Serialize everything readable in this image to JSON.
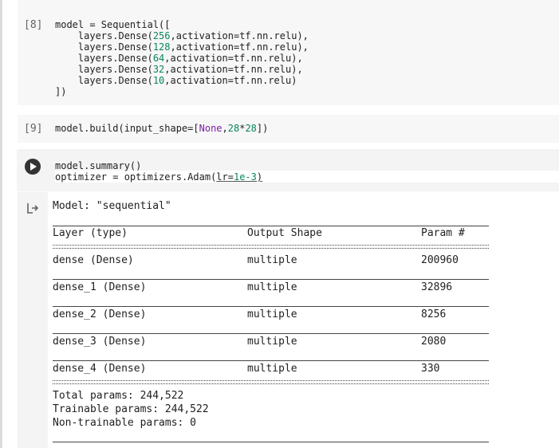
{
  "cells": [
    {
      "exec_count": "[8]",
      "lines": [
        "model = Sequential([",
        "    layers.Dense(256,activation=tf.nn.relu),",
        "    layers.Dense(128,activation=tf.nn.relu),",
        "    layers.Dense(64,activation=tf.nn.relu),",
        "    layers.Dense(32,activation=tf.nn.relu),",
        "    layers.Dense(10,activation=tf.nn.relu)",
        "])"
      ]
    },
    {
      "exec_count": "[9]",
      "code_prefix": "model.build(input_shape=[",
      "code_none": "None",
      "code_sep": ",",
      "code_num1": "28",
      "code_star": "*",
      "code_num2": "28",
      "code_suffix": "])"
    },
    {
      "line1": "model.summary()",
      "line2_prefix": "optimizer = optimizers.Adam(",
      "line2_arg": "lr",
      "line2_eq": "=",
      "line2_val": "1e-3",
      "line2_suffix": ")"
    }
  ],
  "output": {
    "model_name": "Model: \"sequential\"",
    "header": {
      "layer": "Layer (type)",
      "shape": "Output Shape",
      "param": "Param #"
    },
    "rows": [
      {
        "layer": "dense (Dense)",
        "shape": "multiple",
        "param": "200960"
      },
      {
        "layer": "dense_1 (Dense)",
        "shape": "multiple",
        "param": "32896"
      },
      {
        "layer": "dense_2 (Dense)",
        "shape": "multiple",
        "param": "8256"
      },
      {
        "layer": "dense_3 (Dense)",
        "shape": "multiple",
        "param": "2080"
      },
      {
        "layer": "dense_4 (Dense)",
        "shape": "multiple",
        "param": "330"
      }
    ],
    "total": "Total params: 244,522",
    "trainable": "Trainable params: 244,522",
    "non_trainable": "Non-trainable params: 0"
  },
  "icons": {
    "run": "play-icon",
    "output": "output-redirect-icon"
  }
}
